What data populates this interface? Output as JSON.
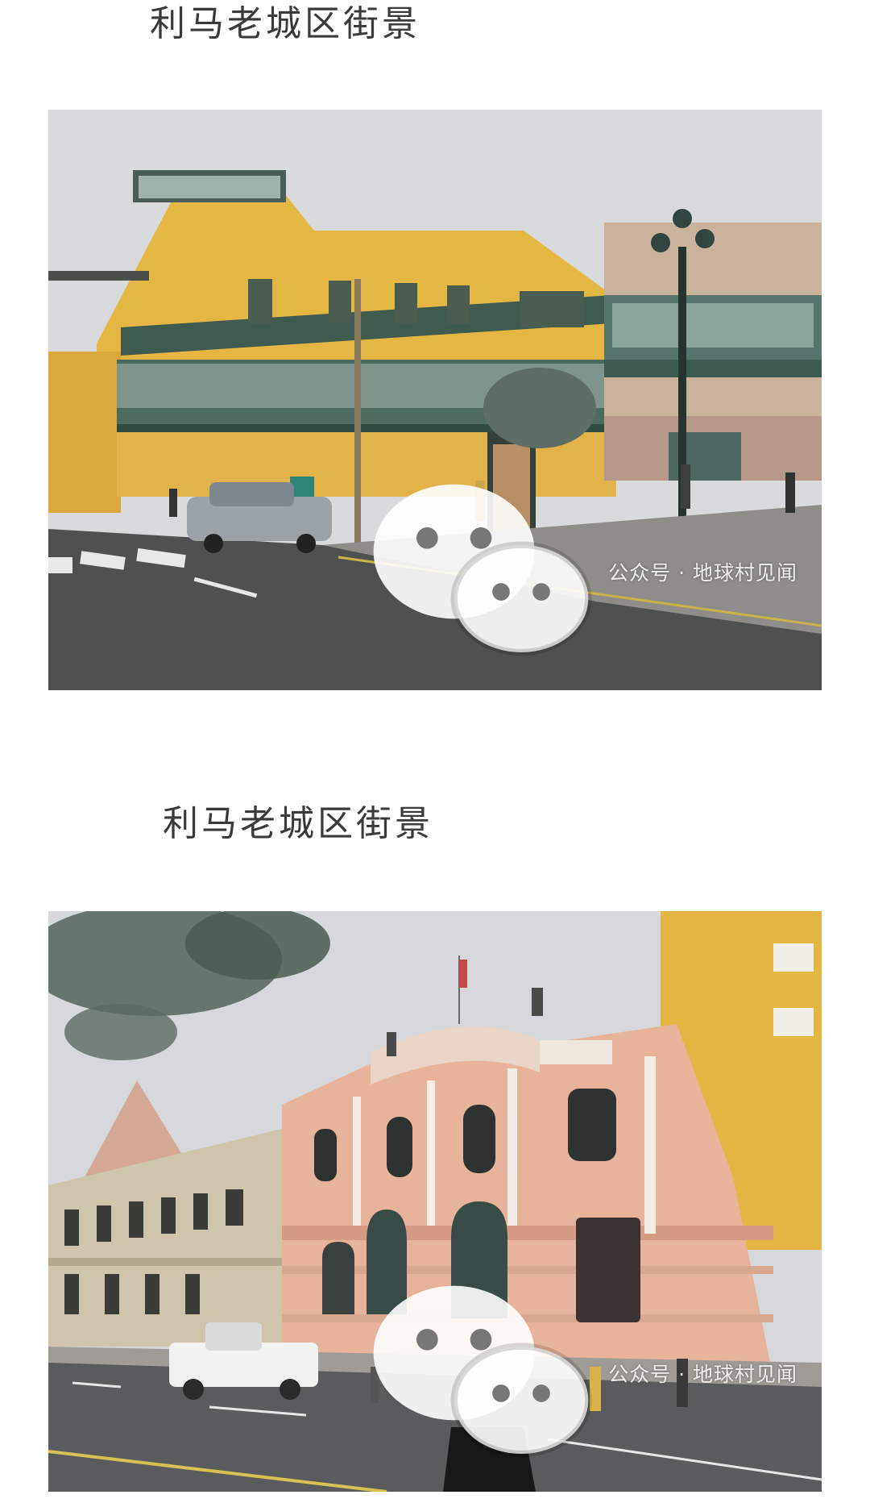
{
  "article": {
    "sections": [
      {
        "caption": "利马老城区街景",
        "watermark": {
          "icon": "wechat-icon",
          "text": "公众号 · 地球村见闻"
        }
      },
      {
        "caption": "利马老城区街景",
        "watermark": {
          "icon": "wechat-icon",
          "text": "公众号 · 地球村见闻"
        }
      }
    ]
  }
}
